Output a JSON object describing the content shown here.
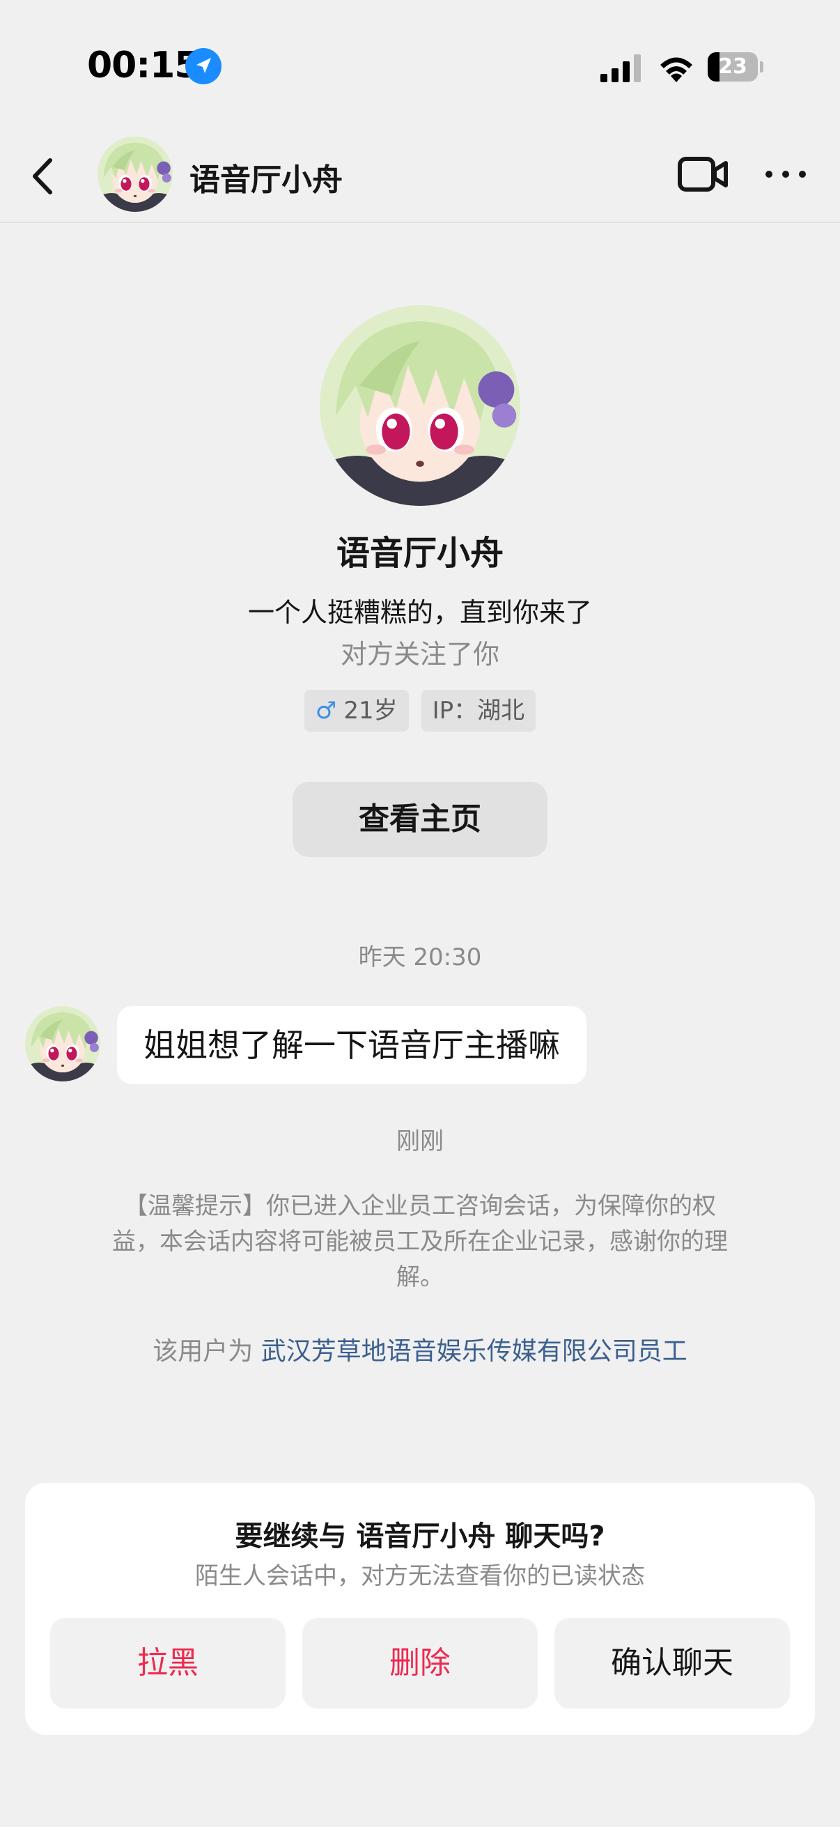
{
  "status_bar": {
    "time": "00:15",
    "battery_percent": "23",
    "battery_level": 0.23,
    "icons": [
      "location-arrow-icon",
      "signal-icon",
      "wifi-icon",
      "battery-icon"
    ]
  },
  "header": {
    "title": "语音厅小舟",
    "icons": [
      "back-icon",
      "avatar",
      "video-call-icon",
      "more-icon"
    ]
  },
  "profile": {
    "name": "语音厅小舟",
    "bio": "一个人挺糟糕的，直到你来了",
    "follow_status": "对方关注了你",
    "gender_symbol": "♂",
    "age": "21岁",
    "ip": "IP：湖北",
    "homepage_button": "查看主页"
  },
  "chat": {
    "timestamp_1": "昨天 20:30",
    "message_1": "姐姐想了解一下语音厅主播嘛",
    "timestamp_2": "刚刚",
    "tip": "【温馨提示】你已进入企业员工咨询会话，为保障你的权益，本会话内容将可能被员工及所在企业记录，感谢你的理解。",
    "employee_prefix": "该用户为",
    "employee_company": "武汉芳草地语音娱乐传媒有限公司员工"
  },
  "prompt": {
    "title": "要继续与 语音厅小舟 聊天吗?",
    "subtitle": "陌生人会话中，对方无法查看你的已读状态",
    "block_label": "拉黑",
    "delete_label": "删除",
    "confirm_label": "确认聊天"
  },
  "colors": {
    "background": "#f0f0f0",
    "danger": "#ef2a4f",
    "link": "#3b5f8f",
    "location_blue": "#1a8cff",
    "male_blue": "#3d8ee8"
  }
}
